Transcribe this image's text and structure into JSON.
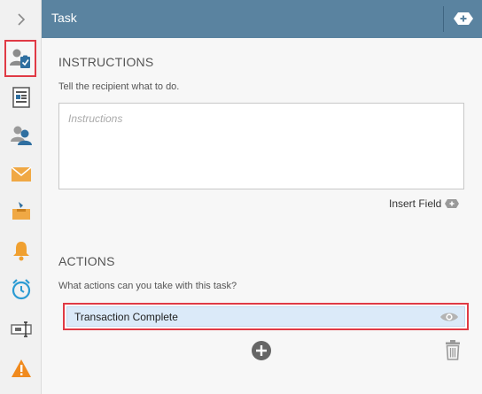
{
  "sidebar": {
    "collapse_icon": "chevron-right-icon",
    "items": [
      {
        "name": "task-icon",
        "active": true
      },
      {
        "name": "form-icon",
        "active": false
      },
      {
        "name": "users-icon",
        "active": false
      },
      {
        "name": "email-icon",
        "active": false
      },
      {
        "name": "inbox-icon",
        "active": false
      },
      {
        "name": "bell-icon",
        "active": false
      },
      {
        "name": "timer-icon",
        "active": false
      },
      {
        "name": "text-field-icon",
        "active": false
      },
      {
        "name": "warning-icon",
        "active": false
      }
    ]
  },
  "header": {
    "title": "Task",
    "add_icon": "add-plus-icon"
  },
  "instructions": {
    "heading": "INSTRUCTIONS",
    "hint": "Tell the recipient what to do.",
    "placeholder": "Instructions",
    "value": "",
    "insert_field_label": "Insert Field"
  },
  "actions": {
    "heading": "ACTIONS",
    "hint": "What actions can you take with this task?",
    "items": [
      {
        "label": "Transaction Complete",
        "selected": true
      }
    ]
  },
  "colors": {
    "header_bg": "#5a83a0",
    "highlight": "#e03a45",
    "selected_row": "#dbeaf9",
    "email_icon": "#f0a844",
    "bell_icon": "#f0a030",
    "timer_icon": "#2b9bd3",
    "warning_icon": "#f08a1e"
  }
}
